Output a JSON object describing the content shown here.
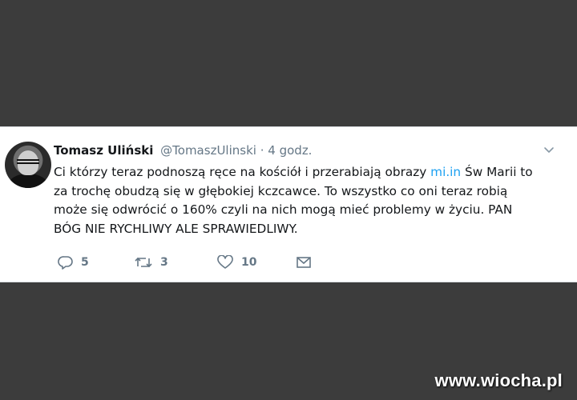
{
  "tweet": {
    "author_name": "Tomasz Uliński",
    "handle": "@TomaszUlinski",
    "separator": "·",
    "time": "4 godz.",
    "text_before_link": "Ci którzy teraz podnoszą ręce na kościół i przerabiają obrazy ",
    "link_text": "mi.in",
    "text_after_link": " Św Marii to za trochę obudzą się w głębokiej kczcawce. To wszystko co oni teraz robią może się odwrócić o 160% czyli na nich mogą mieć problemy w życiu. PAN BÓG NIE RYCHLIWY ALE SPRAWIEDLIWY.",
    "actions": {
      "reply_count": "5",
      "retweet_count": "3",
      "like_count": "10"
    }
  },
  "icons": [
    "chevron-down-icon",
    "reply-icon",
    "retweet-icon",
    "like-icon",
    "message-icon"
  ],
  "colors": {
    "background": "#3c3c3c",
    "card": "#ffffff",
    "link": "#1da1f2",
    "muted": "#657786",
    "text": "#14171a"
  },
  "watermark": "www.wiocha.pl"
}
